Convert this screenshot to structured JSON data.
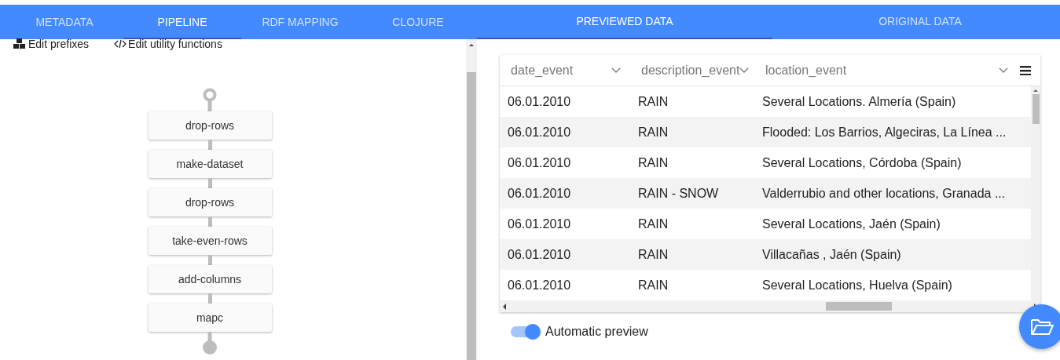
{
  "left_tabs": [
    {
      "label": "METADATA",
      "selected": false
    },
    {
      "label": "PIPELINE",
      "selected": true
    },
    {
      "label": "RDF MAPPING",
      "selected": false
    },
    {
      "label": "CLOJURE",
      "selected": false
    }
  ],
  "toolbar": [
    {
      "kind": "prefixes",
      "label": "Edit prefixes"
    },
    {
      "kind": "code",
      "label": "Edit utility functions"
    }
  ],
  "pipeline": [
    "drop-rows",
    "make-dataset",
    "drop-rows",
    "take-even-rows",
    "add-columns",
    "mapc"
  ],
  "right_tabs": [
    {
      "label": "PREVIEWED DATA",
      "selected": true
    },
    {
      "label": "ORIGINAL DATA",
      "selected": false
    }
  ],
  "table": {
    "columns": [
      "date_event",
      "description_event",
      "location_event"
    ],
    "rows": [
      [
        "06.01.2010",
        "RAIN",
        "Several Locations. Almería (Spain)"
      ],
      [
        "06.01.2010",
        "RAIN",
        "Flooded: Los Barrios, Algeciras, La Línea ..."
      ],
      [
        "06.01.2010",
        "RAIN",
        "Several Locations, Córdoba (Spain)"
      ],
      [
        "06.01.2010",
        "RAIN - SNOW",
        "Valderrubio and other locations, Granada ..."
      ],
      [
        "06.01.2010",
        "RAIN",
        "Several Locations, Jaén (Spain)"
      ],
      [
        "06.01.2010",
        "RAIN",
        "Villacañas , Jaén (Spain)"
      ],
      [
        "06.01.2010",
        "RAIN",
        "Several Locations, Huelva (Spain)"
      ]
    ]
  },
  "automatic_preview": {
    "label": "Automatic preview",
    "on": true
  }
}
